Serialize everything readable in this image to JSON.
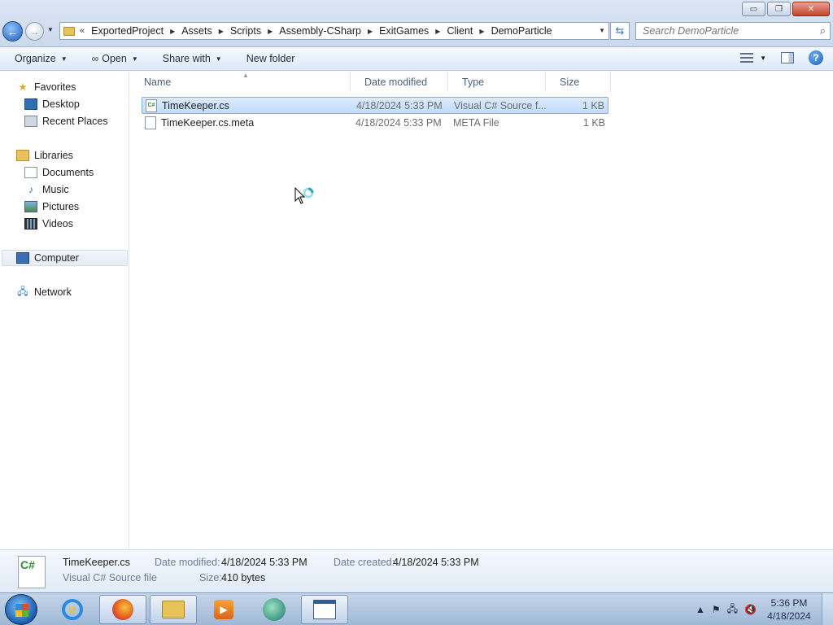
{
  "window": {
    "minimize_label": "▭",
    "maximize_label": "❐",
    "close_label": "✕"
  },
  "address_bar": {
    "lead": "«",
    "breadcrumbs": [
      "ExportedProject",
      "Assets",
      "Scripts",
      "Assembly-CSharp",
      "ExitGames",
      "Client",
      "DemoParticle"
    ]
  },
  "search": {
    "placeholder": "Search DemoParticle"
  },
  "toolbar": {
    "organize": "Organize",
    "open": "Open",
    "share_with": "Share with",
    "new_folder": "New folder"
  },
  "navigation": {
    "favorites": "Favorites",
    "desktop": "Desktop",
    "recent_places": "Recent Places",
    "libraries": "Libraries",
    "documents": "Documents",
    "music": "Music",
    "pictures": "Pictures",
    "videos": "Videos",
    "computer": "Computer",
    "network": "Network"
  },
  "columns": {
    "name": "Name",
    "date_modified": "Date modified",
    "type": "Type",
    "size": "Size"
  },
  "files": [
    {
      "name": "TimeKeeper.cs",
      "date": "4/18/2024 5:33 PM",
      "type": "Visual C# Source f...",
      "size": "1 KB",
      "icon": "csharp-file-icon",
      "selected": true
    },
    {
      "name": "TimeKeeper.cs.meta",
      "date": "4/18/2024 5:33 PM",
      "type": "META File",
      "size": "1 KB",
      "icon": "blank-file-icon",
      "selected": false
    }
  ],
  "details": {
    "file_name": "TimeKeeper.cs",
    "file_type": "Visual C# Source file",
    "date_modified_label": "Date modified:",
    "date_modified": "4/18/2024 5:33 PM",
    "date_created_label": "Date created:",
    "date_created": "4/18/2024 5:33 PM",
    "size_label": "Size:",
    "size": "410 bytes"
  },
  "taskbar": {
    "clock_time": "5:36 PM",
    "clock_date": "4/18/2024",
    "pinned": [
      "internet-explorer-icon",
      "firefox-icon",
      "windows-explorer-icon",
      "media-player-icon",
      "green-app-icon",
      "window-app-icon"
    ]
  }
}
